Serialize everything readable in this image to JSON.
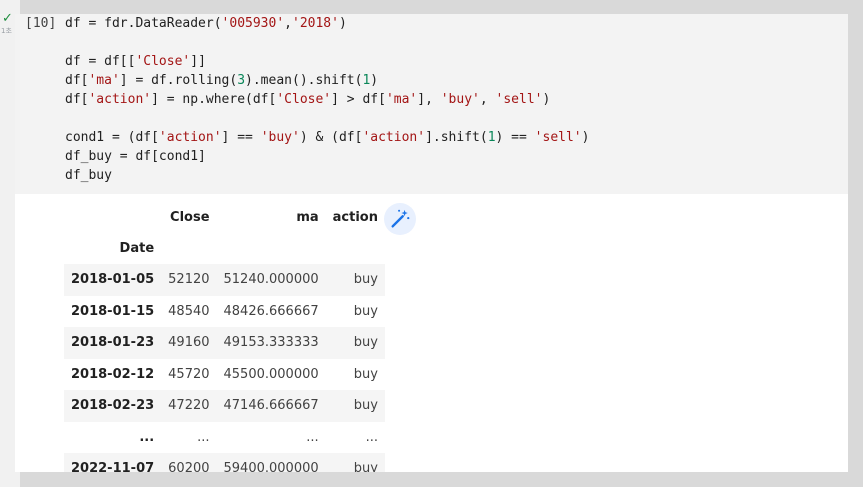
{
  "gutter": {
    "check_glyph": "✓",
    "run_time": "1초"
  },
  "cell": {
    "execution_count": "[10]",
    "code_lines": [
      [
        {
          "t": "df = fdr.DataReader("
        },
        {
          "t": "'005930'",
          "c": "s"
        },
        {
          "t": ","
        },
        {
          "t": "'2018'",
          "c": "s"
        },
        {
          "t": ")"
        }
      ],
      [],
      [
        {
          "t": "df = df[["
        },
        {
          "t": "'Close'",
          "c": "s"
        },
        {
          "t": "]]"
        }
      ],
      [
        {
          "t": "df["
        },
        {
          "t": "'ma'",
          "c": "s"
        },
        {
          "t": "] = df.rolling("
        },
        {
          "t": "3",
          "c": "n"
        },
        {
          "t": ").mean().shift("
        },
        {
          "t": "1",
          "c": "n"
        },
        {
          "t": ")"
        }
      ],
      [
        {
          "t": "df["
        },
        {
          "t": "'action'",
          "c": "s"
        },
        {
          "t": "] = np.where(df["
        },
        {
          "t": "'Close'",
          "c": "s"
        },
        {
          "t": "] > df["
        },
        {
          "t": "'ma'",
          "c": "s"
        },
        {
          "t": "], "
        },
        {
          "t": "'buy'",
          "c": "s"
        },
        {
          "t": ", "
        },
        {
          "t": "'sell'",
          "c": "s"
        },
        {
          "t": ")"
        }
      ],
      [],
      [
        {
          "t": "cond1 = (df["
        },
        {
          "t": "'action'",
          "c": "s"
        },
        {
          "t": "] == "
        },
        {
          "t": "'buy'",
          "c": "s"
        },
        {
          "t": ") & (df["
        },
        {
          "t": "'action'",
          "c": "s"
        },
        {
          "t": "].shift("
        },
        {
          "t": "1",
          "c": "n"
        },
        {
          "t": ") == "
        },
        {
          "t": "'sell'",
          "c": "s"
        },
        {
          "t": ")"
        }
      ],
      [
        {
          "t": "df_buy = df[cond1]"
        }
      ],
      [
        {
          "t": "df_buy"
        }
      ]
    ]
  },
  "output": {
    "columns": [
      "Close",
      "ma",
      "action"
    ],
    "index_name": "Date",
    "rows": [
      {
        "date": "2018-01-05",
        "close": "52120",
        "ma": "51240.000000",
        "action": "buy"
      },
      {
        "date": "2018-01-15",
        "close": "48540",
        "ma": "48426.666667",
        "action": "buy"
      },
      {
        "date": "2018-01-23",
        "close": "49160",
        "ma": "49153.333333",
        "action": "buy"
      },
      {
        "date": "2018-02-12",
        "close": "45720",
        "ma": "45500.000000",
        "action": "buy"
      },
      {
        "date": "2018-02-23",
        "close": "47220",
        "ma": "47146.666667",
        "action": "buy"
      },
      {
        "date": "...",
        "close": "...",
        "ma": "...",
        "action": "..."
      },
      {
        "date": "2022-11-07",
        "close": "60200",
        "ma": "59400.000000",
        "action": "buy"
      }
    ]
  },
  "icons": {
    "wand": "magic-wand-icon"
  },
  "colors": {
    "string": "#a31515",
    "number": "#098658",
    "wand_bg": "#e8f0fe",
    "wand_fg": "#1a73e8"
  }
}
